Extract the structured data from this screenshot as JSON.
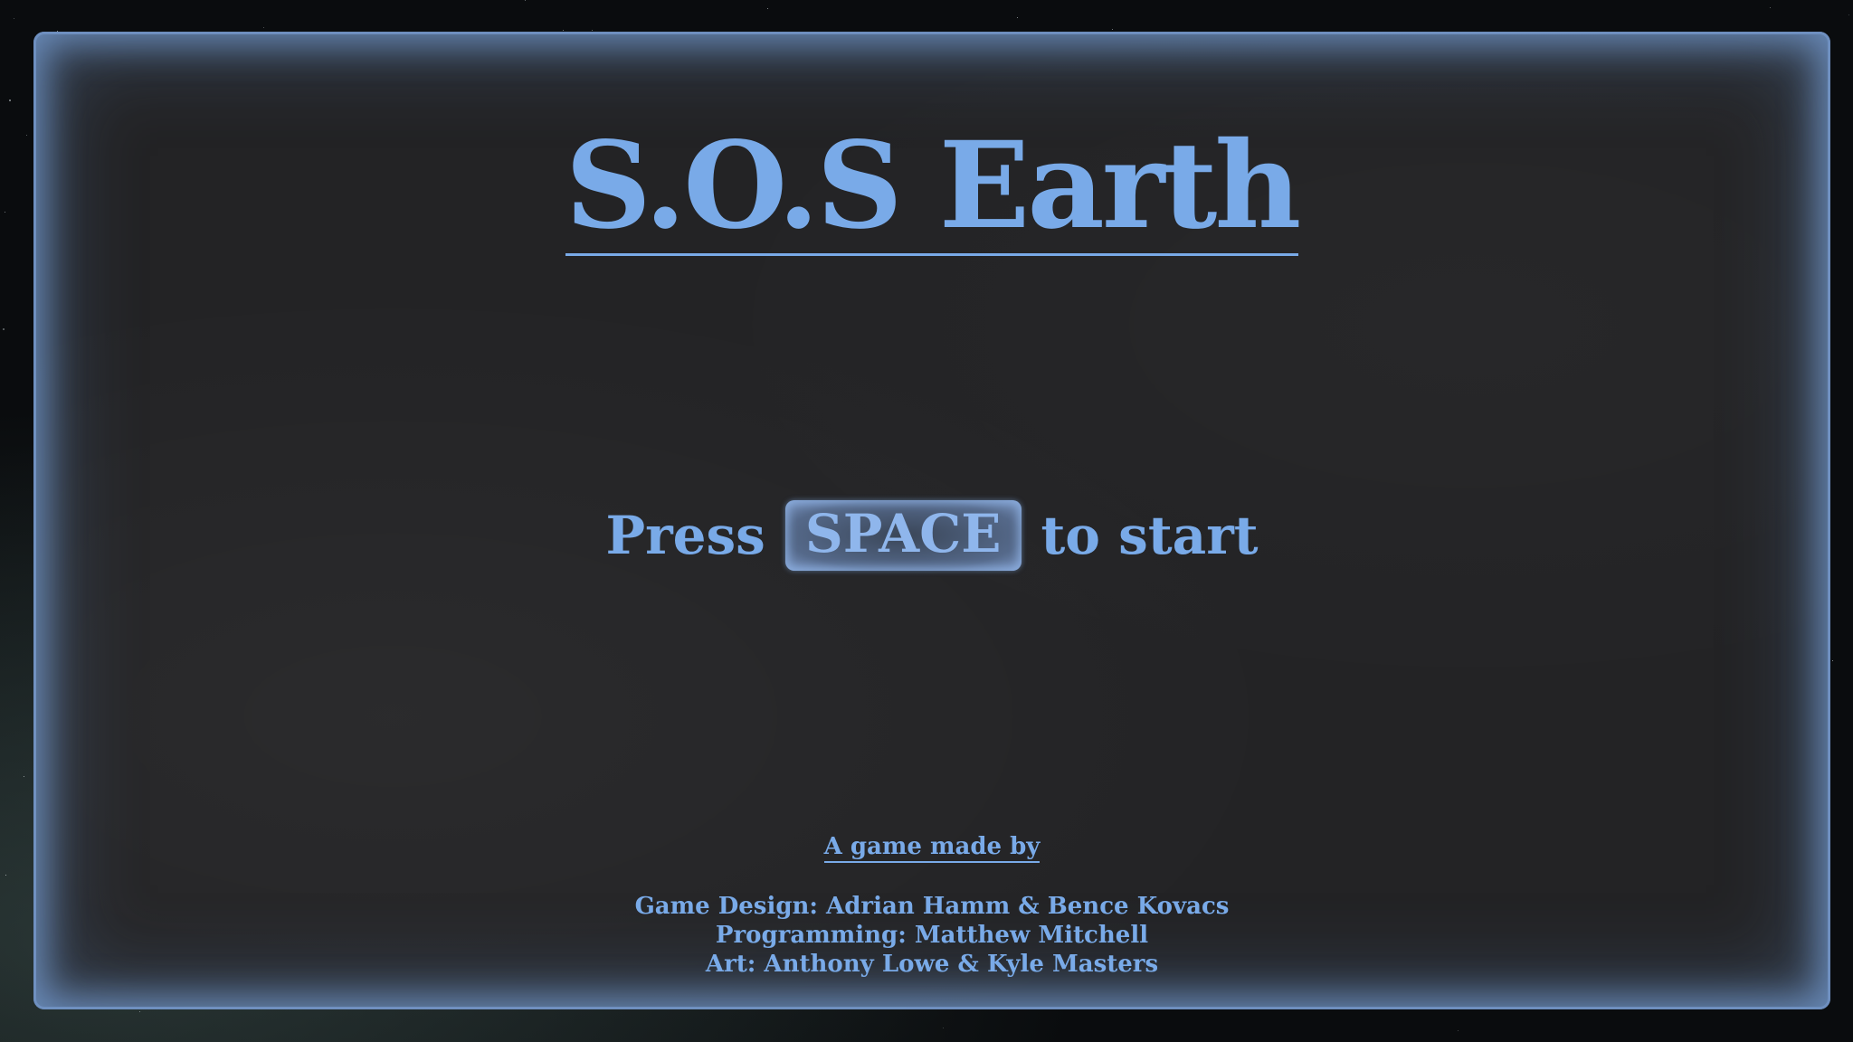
{
  "game": {
    "title": "S.O.S Earth",
    "start_prompt": {
      "prefix": "Press",
      "key": "SPACE",
      "suffix": "to start"
    },
    "credits": {
      "heading": "A game made by",
      "lines": [
        "Game Design: Adrian Hamm & Bence Kovacs",
        "Programming: Matthew Mitchell",
        "Art: Anthony Lowe & Kyle Masters"
      ]
    }
  },
  "colors": {
    "accent": "#79aae8",
    "panel": "#232325",
    "background": "#0a0c0e"
  }
}
